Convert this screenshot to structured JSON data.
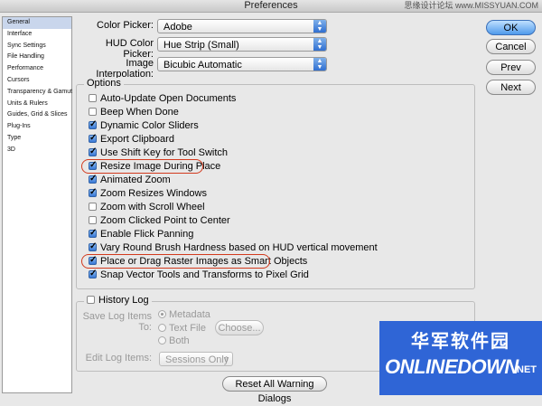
{
  "window": {
    "title": "Preferences",
    "watermark": "思缘设计论坛  www.MISSYUAN.COM"
  },
  "sidebar": {
    "items": [
      {
        "label": "General",
        "selected": true
      },
      {
        "label": "Interface"
      },
      {
        "label": "Sync Settings"
      },
      {
        "label": "File Handling"
      },
      {
        "label": "Performance"
      },
      {
        "label": "Cursors"
      },
      {
        "label": "Transparency & Gamut"
      },
      {
        "label": "Units & Rulers"
      },
      {
        "label": "Guides, Grid & Slices"
      },
      {
        "label": "Plug-Ins"
      },
      {
        "label": "Type"
      },
      {
        "label": "3D"
      }
    ]
  },
  "fields": {
    "color_picker": {
      "label": "Color Picker:",
      "value": "Adobe"
    },
    "hud_color_picker": {
      "label": "HUD Color Picker:",
      "value": "Hue Strip (Small)"
    },
    "image_interpolation": {
      "label": "Image Interpolation:",
      "value": "Bicubic Automatic"
    }
  },
  "buttons": {
    "ok": "OK",
    "cancel": "Cancel",
    "prev": "Prev",
    "next": "Next",
    "reset": "Reset All Warning Dialogs"
  },
  "options": {
    "title": "Options",
    "items": [
      {
        "label": "Auto-Update Open Documents",
        "checked": false
      },
      {
        "label": "Beep When Done",
        "checked": false
      },
      {
        "label": "Dynamic Color Sliders",
        "checked": true
      },
      {
        "label": "Export Clipboard",
        "checked": true
      },
      {
        "label": "Use Shift Key for Tool Switch",
        "checked": true
      },
      {
        "label": "Resize Image During Place",
        "checked": true
      },
      {
        "label": "Animated Zoom",
        "checked": true
      },
      {
        "label": "Zoom Resizes Windows",
        "checked": true
      },
      {
        "label": "Zoom with Scroll Wheel",
        "checked": false
      },
      {
        "label": "Zoom Clicked Point to Center",
        "checked": false
      },
      {
        "label": "Enable Flick Panning",
        "checked": true
      },
      {
        "label": "Vary Round Brush Hardness based on HUD vertical movement",
        "checked": true
      },
      {
        "label": "Place or Drag Raster Images as Smart Objects",
        "checked": true
      },
      {
        "label": "Snap Vector Tools and Transforms to Pixel Grid",
        "checked": true
      }
    ]
  },
  "history_log": {
    "title": "History Log",
    "checked": false,
    "save_label": "Save Log Items To:",
    "radio_metadata": "Metadata",
    "radio_text_file": "Text File",
    "radio_both": "Both",
    "choose": "Choose...",
    "edit_label": "Edit Log Items:",
    "edit_value": "Sessions Only"
  },
  "watermark_logo": {
    "cn": "华军软件园",
    "en": "ONLINEDOWN",
    "net": ".NET"
  },
  "colors": {
    "accent": "#3878d6",
    "highlight": "#d23a1e",
    "logo_bg": "#2f65d6"
  }
}
